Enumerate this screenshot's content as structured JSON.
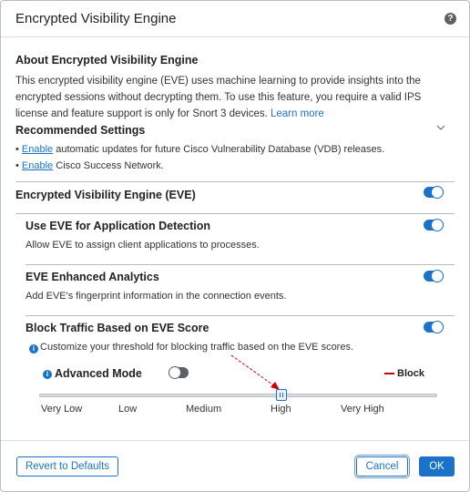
{
  "dialog": {
    "title": "Encrypted Visibility Engine",
    "help_icon": "question-circle-icon"
  },
  "about": {
    "heading": "About Encrypted Visibility Engine",
    "text": "This encrypted visibility engine (EVE) uses machine learning to provide insights into the encrypted sessions without decrypting them. To use this feature, you require a valid IPS license and feature support is only for Snort 3 devices.",
    "learn_more": "Learn more"
  },
  "recommended": {
    "heading": "Recommended Settings",
    "chevron_icon": "chevron-down-icon",
    "items": [
      {
        "bullet": "•",
        "link": "Enable",
        "text": " automatic updates for future Cisco Vulnerability Database (VDB) releases."
      },
      {
        "bullet": "•",
        "link": "Enable",
        "text": " Cisco Success Network."
      }
    ]
  },
  "eve": {
    "title": "Encrypted Visibility Engine (EVE)",
    "enabled": true
  },
  "app_detection": {
    "title": "Use EVE for Application Detection",
    "description": "Allow EVE to assign client applications to processes.",
    "enabled": true
  },
  "enhanced_analytics": {
    "title": "EVE Enhanced Analytics",
    "description": "Add EVE's fingerprint information in the connection events.",
    "enabled": true
  },
  "block_traffic": {
    "title": "Block Traffic Based on EVE Score",
    "info_text": "Customize your threshold for blocking traffic based on the EVE scores.",
    "enabled": true,
    "advanced_mode_label": "Advanced Mode",
    "advanced_mode_enabled": false,
    "legend_label": "Block",
    "legend_color": "#cc0000",
    "threshold_levels": [
      "Very Low",
      "Low",
      "Medium",
      "High",
      "Very High"
    ],
    "selected_level": "High"
  },
  "footer": {
    "revert_label": "Revert to Defaults",
    "cancel_label": "Cancel",
    "ok_label": "OK"
  },
  "colors": {
    "accent": "#1a73c9",
    "annotation_arrow": "#cc0000"
  }
}
